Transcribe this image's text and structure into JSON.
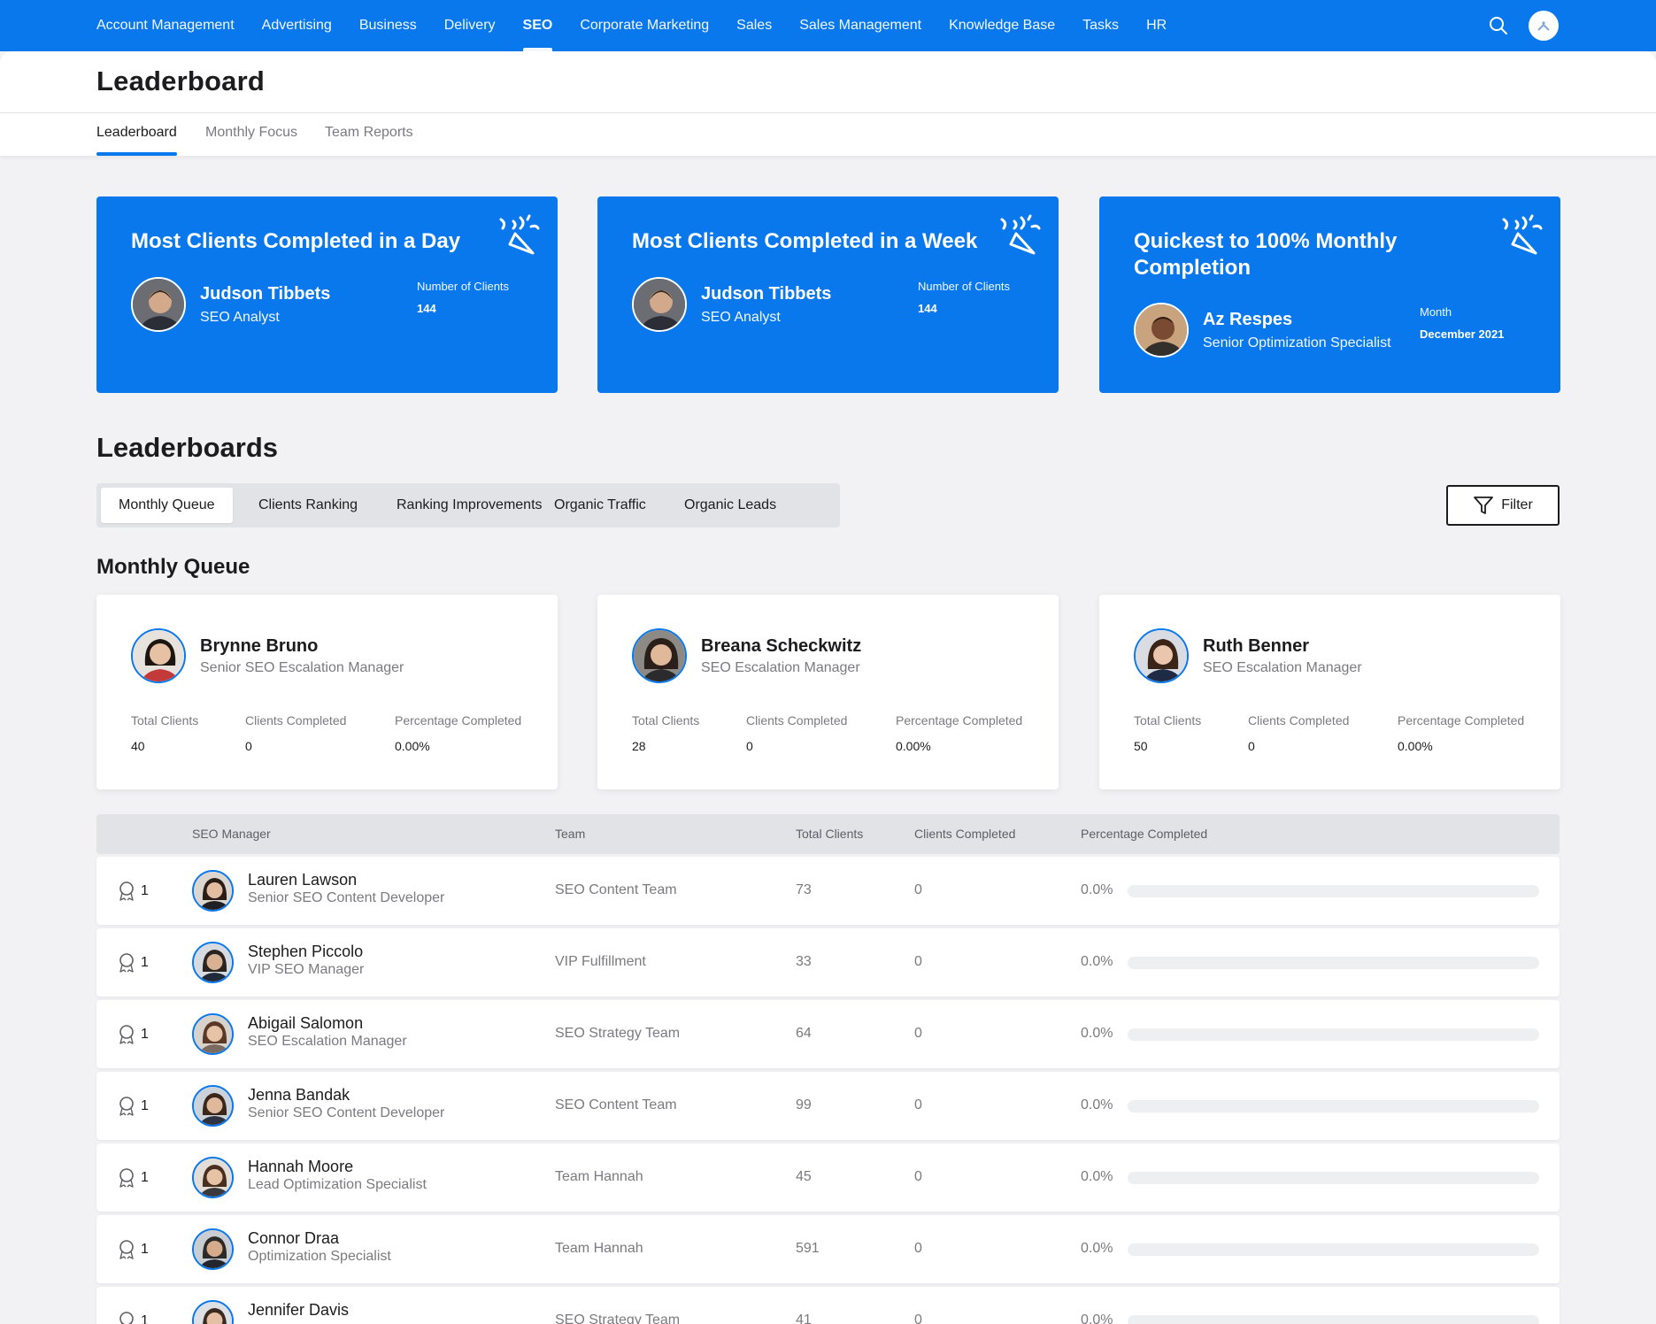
{
  "nav": {
    "items": [
      {
        "label": "Account Management",
        "active": false
      },
      {
        "label": "Advertising",
        "active": false
      },
      {
        "label": "Business",
        "active": false
      },
      {
        "label": "Delivery",
        "active": false
      },
      {
        "label": "SEO",
        "active": true
      },
      {
        "label": "Corporate Marketing",
        "active": false
      },
      {
        "label": "Sales",
        "active": false
      },
      {
        "label": "Sales Management",
        "active": false
      },
      {
        "label": "Knowledge Base",
        "active": false
      },
      {
        "label": "Tasks",
        "active": false
      },
      {
        "label": "HR",
        "active": false
      }
    ],
    "search_icon": "search-icon",
    "avatar_icon": "user-avatar"
  },
  "header": {
    "title": "Leaderboard"
  },
  "subtabs": [
    {
      "label": "Leaderboard",
      "active": true
    },
    {
      "label": "Monthly Focus",
      "active": false
    },
    {
      "label": "Team Reports",
      "active": false
    }
  ],
  "awards": [
    {
      "title": "Most Clients Completed in a Day",
      "name": "Judson Tibbets",
      "role": "SEO Analyst",
      "stat_label": "Number of Clients",
      "stat_value": "144",
      "icon": "party-popper-icon"
    },
    {
      "title": "Most Clients Completed in a Week",
      "name": "Judson Tibbets",
      "role": "SEO Analyst",
      "stat_label": "Number of Clients",
      "stat_value": "144",
      "icon": "party-popper-icon"
    },
    {
      "title": "Quickest to 100% Monthly Completion",
      "name": "Az Respes",
      "role": "Senior Optimization Specialist",
      "stat_label": "Month",
      "stat_value": "December 2021",
      "icon": "party-popper-icon"
    }
  ],
  "leaderboards": {
    "title": "Leaderboards",
    "tabs": [
      {
        "label": "Monthly Queue",
        "active": true
      },
      {
        "label": "Clients Ranking",
        "active": false
      },
      {
        "label": "Ranking Improvements",
        "active": false
      },
      {
        "label": "Organic Traffic",
        "active": false
      },
      {
        "label": "Organic Leads",
        "active": false
      }
    ],
    "filter_label": "Filter"
  },
  "monthly_queue": {
    "title": "Monthly Queue",
    "labels": {
      "total": "Total Clients",
      "completed": "Clients Completed",
      "pct": "Percentage Completed"
    },
    "cards": [
      {
        "name": "Brynne Bruno",
        "role": "Senior SEO Escalation Manager",
        "total": "40",
        "completed": "0",
        "pct": "0.00%"
      },
      {
        "name": "Breana Scheckwitz",
        "role": "SEO Escalation Manager",
        "total": "28",
        "completed": "0",
        "pct": "0.00%"
      },
      {
        "name": "Ruth Benner",
        "role": "SEO Escalation Manager",
        "total": "50",
        "completed": "0",
        "pct": "0.00%"
      }
    ]
  },
  "table": {
    "headers": {
      "manager": "SEO Manager",
      "team": "Team",
      "total": "Total Clients",
      "completed": "Clients Completed",
      "pct": "Percentage Completed"
    },
    "rows": [
      {
        "rank": "1",
        "name": "Lauren Lawson",
        "role": "Senior SEO Content Developer",
        "team": "SEO Content Team",
        "total": "73",
        "completed": "0",
        "pct": "0.0%",
        "progress": 0
      },
      {
        "rank": "1",
        "name": "Stephen Piccolo",
        "role": "VIP SEO Manager",
        "team": "VIP Fulfillment",
        "total": "33",
        "completed": "0",
        "pct": "0.0%",
        "progress": 0
      },
      {
        "rank": "1",
        "name": "Abigail Salomon",
        "role": "SEO Escalation Manager",
        "team": "SEO Strategy Team",
        "total": "64",
        "completed": "0",
        "pct": "0.0%",
        "progress": 0
      },
      {
        "rank": "1",
        "name": "Jenna Bandak",
        "role": "Senior SEO Content Developer",
        "team": "SEO Content Team",
        "total": "99",
        "completed": "0",
        "pct": "0.0%",
        "progress": 0
      },
      {
        "rank": "1",
        "name": "Hannah Moore",
        "role": "Lead Optimization Specialist",
        "team": "Team Hannah",
        "total": "45",
        "completed": "0",
        "pct": "0.0%",
        "progress": 0
      },
      {
        "rank": "1",
        "name": "Connor Draa",
        "role": "Optimization Specialist",
        "team": "Team Hannah",
        "total": "591",
        "completed": "0",
        "pct": "0.0%",
        "progress": 0
      },
      {
        "rank": "1",
        "name": "Jennifer Davis",
        "role": "",
        "team": "SEO Strategy Team",
        "total": "41",
        "completed": "0",
        "pct": "0.0%",
        "progress": 0
      }
    ]
  },
  "colors": {
    "accent": "#0878ec",
    "background": "#f2f2f4",
    "muted_text": "#7a7a80"
  }
}
